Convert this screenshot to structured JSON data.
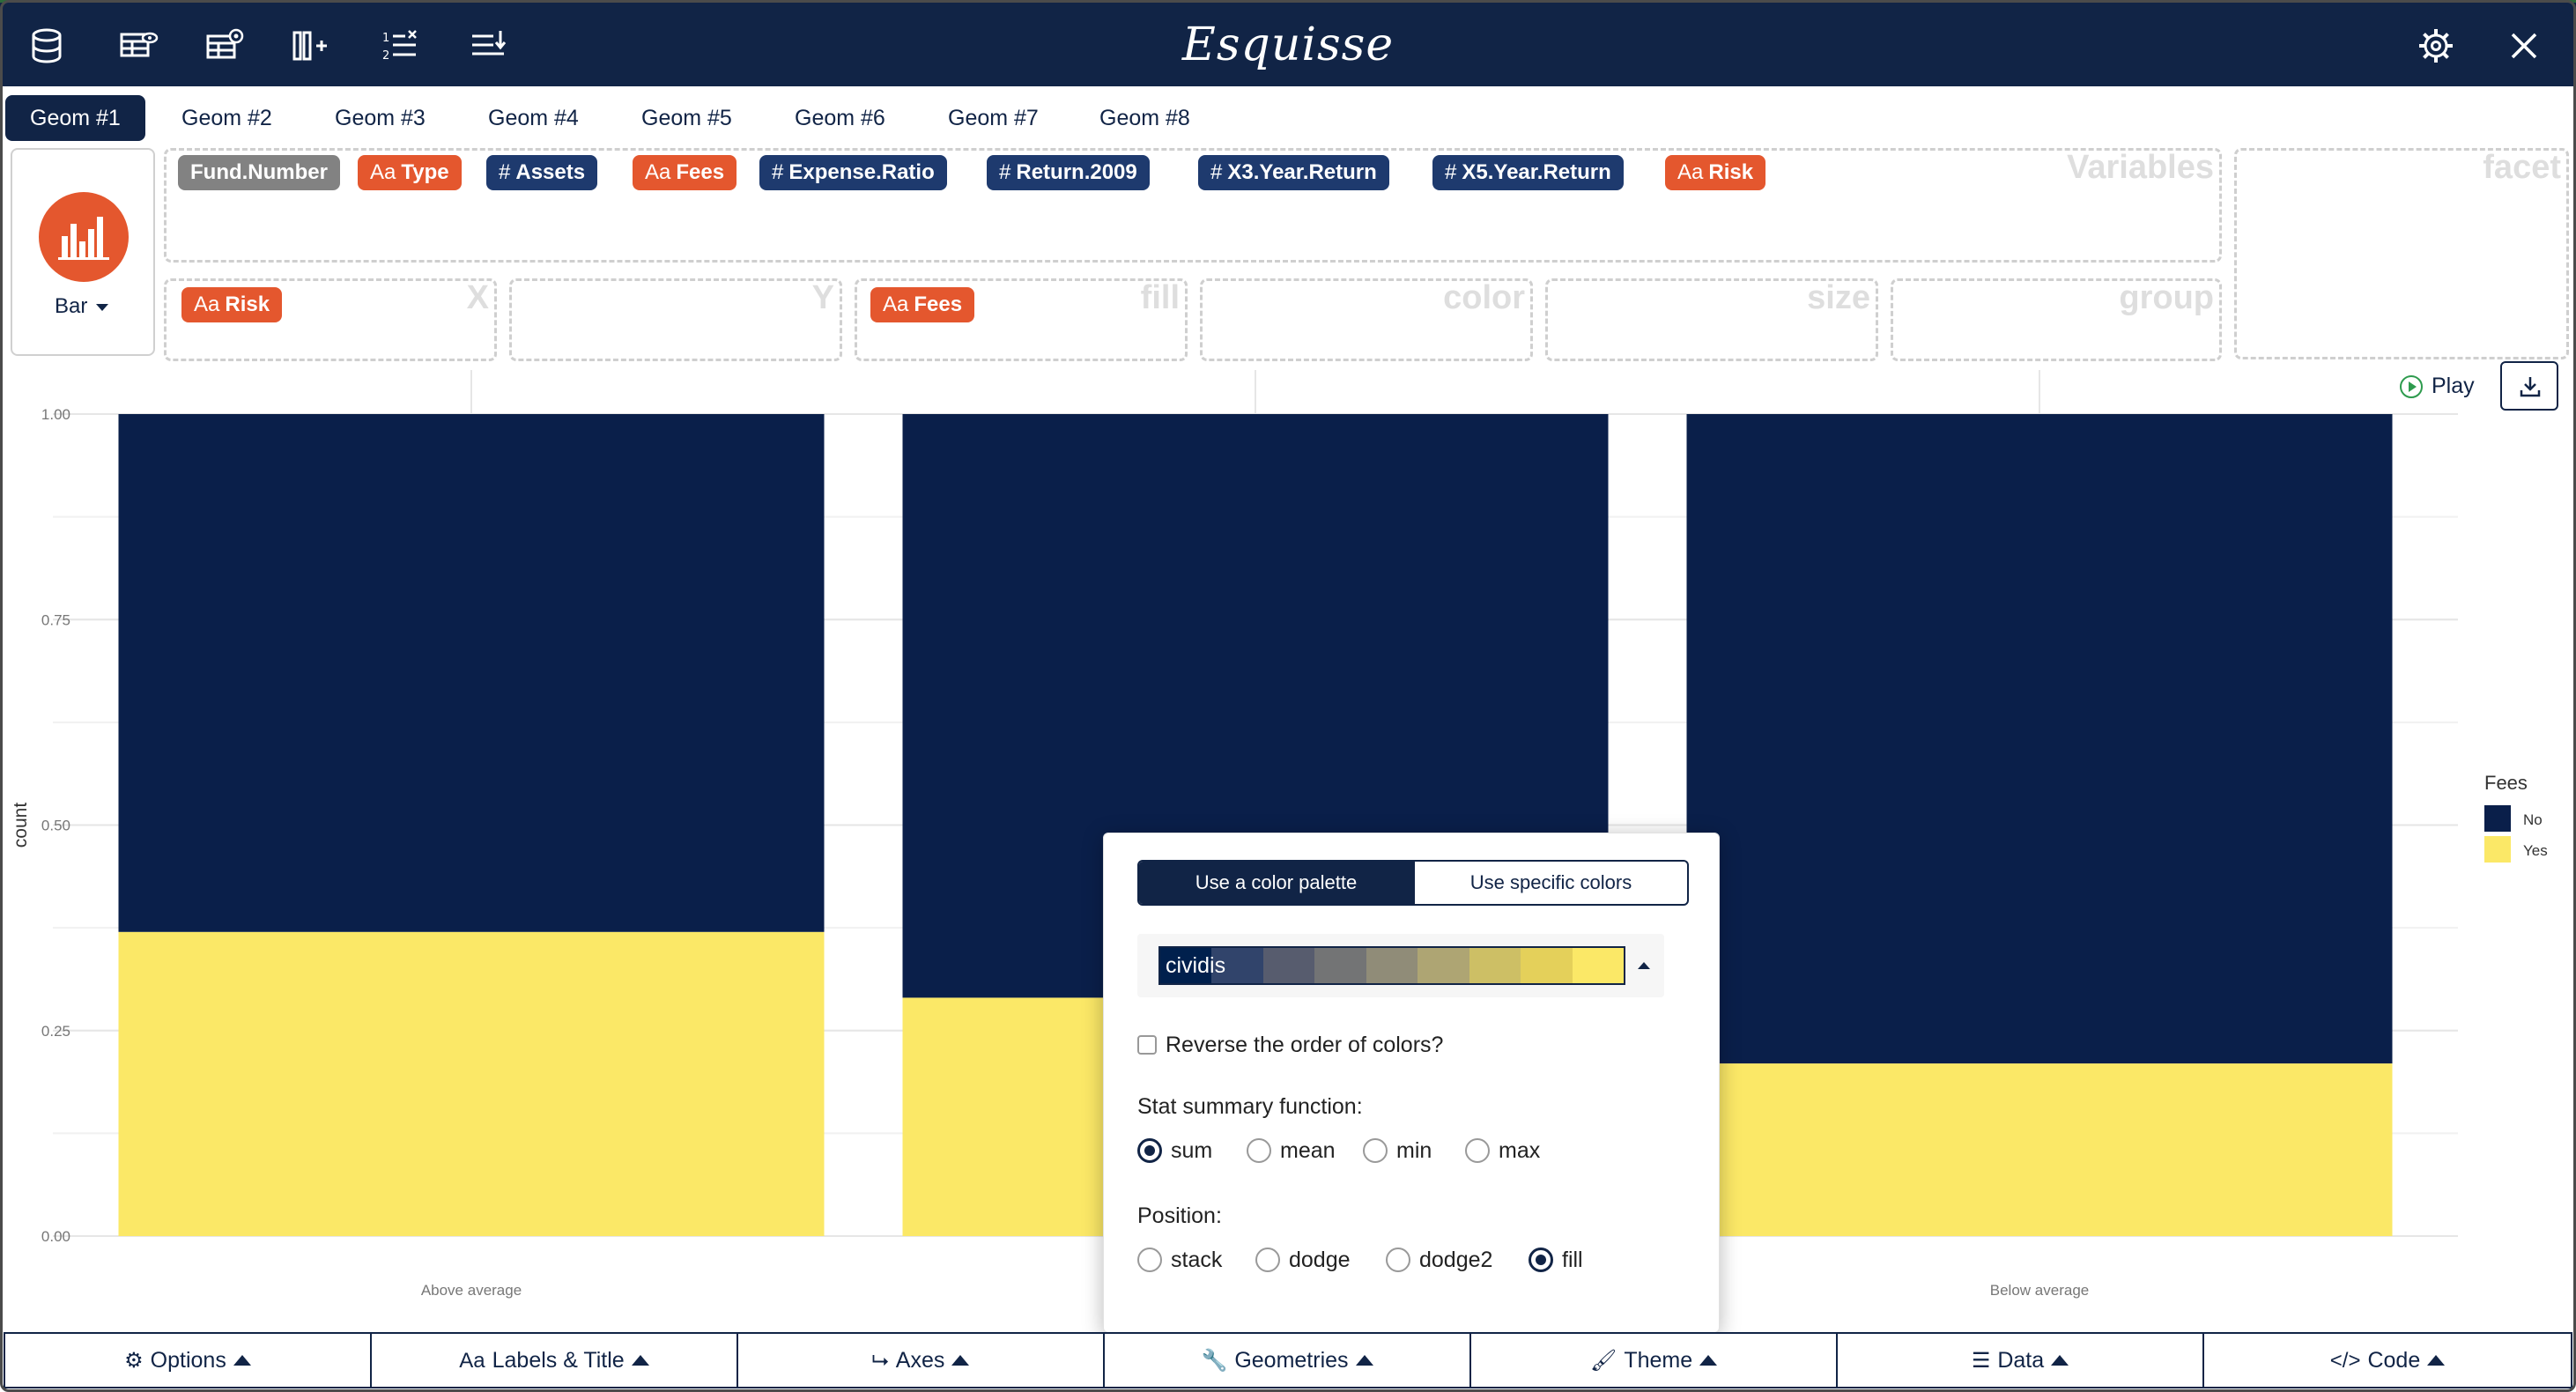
{
  "app": {
    "title": "Esquisse"
  },
  "header_icons": [
    "database-icon",
    "table-view-icon",
    "table-settings-icon",
    "add-column-icon",
    "sort-list-icon",
    "filter-list-icon",
    "settings-icon",
    "close-icon"
  ],
  "tabs": [
    {
      "label": "Geom #1",
      "active": true
    },
    {
      "label": "Geom #2"
    },
    {
      "label": "Geom #3"
    },
    {
      "label": "Geom #4"
    },
    {
      "label": "Geom #5"
    },
    {
      "label": "Geom #6"
    },
    {
      "label": "Geom #7"
    },
    {
      "label": "Geom #8"
    }
  ],
  "geom": {
    "selected": "Bar",
    "accent": "#e4572e"
  },
  "variables": {
    "title": "Variables",
    "items": [
      {
        "prefix": "",
        "label": "Fund.Number",
        "kind": "id"
      },
      {
        "prefix": "Aa",
        "label": "Type",
        "kind": "categorical"
      },
      {
        "prefix": "#",
        "label": "Assets",
        "kind": "numeric"
      },
      {
        "prefix": "Aa",
        "label": "Fees",
        "kind": "categorical"
      },
      {
        "prefix": "#",
        "label": "Expense.Ratio",
        "kind": "numeric"
      },
      {
        "prefix": "#",
        "label": "Return.2009",
        "kind": "numeric"
      },
      {
        "prefix": "#",
        "label": "X3.Year.Return",
        "kind": "numeric"
      },
      {
        "prefix": "#",
        "label": "X5.Year.Return",
        "kind": "numeric"
      },
      {
        "prefix": "Aa",
        "label": "Risk",
        "kind": "categorical"
      }
    ]
  },
  "zones": {
    "facet": "facet",
    "x": {
      "title": "X",
      "badge_prefix": "Aa",
      "badge": "Risk"
    },
    "y": {
      "title": "Y"
    },
    "fill": {
      "title": "fill",
      "badge_prefix": "Aa",
      "badge": "Fees"
    },
    "color": {
      "title": "color"
    },
    "size": {
      "title": "size"
    },
    "group": {
      "title": "group"
    }
  },
  "controls": {
    "play": "Play"
  },
  "chart_data": {
    "type": "bar",
    "stacked": "fill",
    "categories": [
      "Above average",
      "",
      "Below average"
    ],
    "series": [
      {
        "name": "No",
        "color": "#0a1f4a",
        "values": [
          0.63,
          0.71,
          0.79
        ]
      },
      {
        "name": "Yes",
        "color": "#fbe867",
        "values": [
          0.37,
          0.29,
          0.21
        ]
      }
    ],
    "ylabel": "count",
    "yticks": [
      "0.00",
      "0.25",
      "0.50",
      "0.75",
      "1.00"
    ],
    "ylim": [
      0,
      1
    ],
    "grid": true,
    "legend": {
      "title": "Fees",
      "placement": "right"
    }
  },
  "popover": {
    "tab_on": "Use a color palette",
    "tab_off": "Use specific colors",
    "palette_name": "cividis",
    "palette_colors": [
      "#00204d",
      "#31446b",
      "#575c6e",
      "#737475",
      "#908c78",
      "#aea573",
      "#cdbf65",
      "#e4d05a",
      "#fbe867"
    ],
    "reverse_label": "Reverse the order of colors?",
    "stat_label": "Stat summary function:",
    "stat_options": [
      "sum",
      "mean",
      "min",
      "max"
    ],
    "stat_selected": "sum",
    "position_label": "Position:",
    "position_options": [
      "stack",
      "dodge",
      "dodge2",
      "fill"
    ],
    "position_selected": "fill"
  },
  "bottom": [
    {
      "icon": "gear-icon",
      "glyph": "⚙",
      "label": "Options"
    },
    {
      "icon": "text-icon",
      "glyph": "Aa",
      "label": "Labels & Title"
    },
    {
      "icon": "axes-icon",
      "glyph": "⮡",
      "label": "Axes"
    },
    {
      "icon": "wrench-icon",
      "glyph": "🔧",
      "label": "Geometries"
    },
    {
      "icon": "brush-icon",
      "glyph": "🖌",
      "label": "Theme"
    },
    {
      "icon": "sliders-icon",
      "glyph": "☰",
      "label": "Data"
    },
    {
      "icon": "code-icon",
      "glyph": "</>",
      "label": "Code"
    }
  ]
}
